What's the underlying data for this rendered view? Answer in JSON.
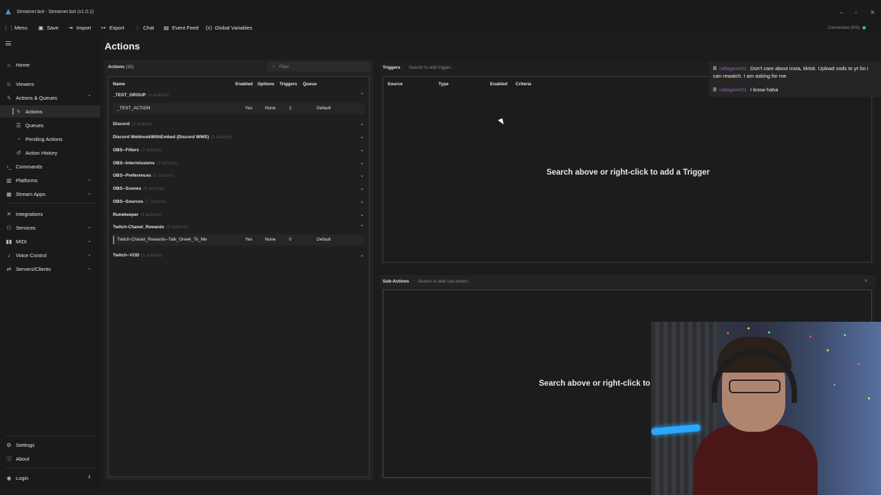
{
  "window": {
    "title": "Streamer.bot - Streamer.bot (v1.0.1)"
  },
  "toolbar": {
    "menu": "Menu",
    "save": "Save",
    "import": "Import",
    "export": "Export",
    "chat": "Chat",
    "event_feed": "Event Feed",
    "global_variables": "Global Variables",
    "connected": "Connected (5/5)"
  },
  "sidebar": {
    "home": "Home",
    "viewers": "Viewers",
    "actions_queues": "Actions & Queues",
    "actions": "Actions",
    "queues": "Queues",
    "pending_actions": "Pending Actions",
    "action_history": "Action History",
    "commands": "Commands",
    "platforms": "Platforms",
    "stream_apps": "Stream Apps",
    "integrations": "Integrations",
    "services": "Services",
    "midi": "MIDI",
    "voice_control": "Voice Control",
    "servers_clients": "Servers/Clients",
    "settings": "Settings",
    "about": "About",
    "login": "Login"
  },
  "page": {
    "title": "Actions"
  },
  "actions_panel": {
    "header": "Actions",
    "count": "(32)",
    "filter_placeholder": "Filter",
    "columns": [
      "Name",
      "Enabled",
      "Options",
      "Triggers",
      "Queue"
    ],
    "groups": [
      {
        "name": "_TEST_GROUP",
        "count": "(1 actions)",
        "expanded": true
      },
      {
        "name": "Discord",
        "count": "(1 actions)",
        "expanded": false
      },
      {
        "name": "Discord WebhookWithEmbed (Discord WWE)",
        "count": "(1 actions)",
        "expanded": false
      },
      {
        "name": "OBS--Filters",
        "count": "(2 actions)",
        "expanded": false
      },
      {
        "name": "OBS--Intermissions",
        "count": "(3 actions)",
        "expanded": false
      },
      {
        "name": "OBS--Preferences",
        "count": "(2 actions)",
        "expanded": false
      },
      {
        "name": "OBS--Scenes",
        "count": "(4 actions)",
        "expanded": false
      },
      {
        "name": "OBS--Sources",
        "count": "(7 actions)",
        "expanded": false
      },
      {
        "name": "Runekeeper",
        "count": "(1 actions)",
        "expanded": false
      },
      {
        "name": "Twitch-Chanel_Rewards",
        "count": "(1 actions)",
        "expanded": true
      },
      {
        "name": "Twitch--VOD",
        "count": "(1 actions)",
        "expanded": false
      }
    ],
    "rows": [
      {
        "name": "_TEST_ACTION",
        "enabled": "Yes",
        "options": "None",
        "triggers": "2",
        "queue": "Default"
      },
      {
        "name": "Twitch-Chanel_Rewards--Talk_Greek_To_Me",
        "enabled": "Yes",
        "options": "None",
        "triggers": "0",
        "queue": "Default"
      }
    ]
  },
  "triggers_panel": {
    "label": "Triggers",
    "search_placeholder": "Search to add trigger...",
    "columns": [
      "Source",
      "Type",
      "Enabled",
      "Criteria"
    ],
    "empty_text": "Search above or right-click to add a Trigger"
  },
  "subactions_panel": {
    "label": "Sub-Actions",
    "search_placeholder": "Search to add sub-action...",
    "empty_text": "Search above or right-click to"
  },
  "chat_overlay": {
    "messages": [
      {
        "user": "radagone01",
        "text": "Don't care about insta, tiktok. Upload vods to yt So i can rewatch. I am asking for me"
      },
      {
        "user": "radagone01",
        "text": "I know haha"
      }
    ]
  },
  "colors": {
    "accent": "#4a90d9",
    "background": "#1c1c1c",
    "connected": "#3fbf5a",
    "chat_user": "#9b59b6"
  }
}
